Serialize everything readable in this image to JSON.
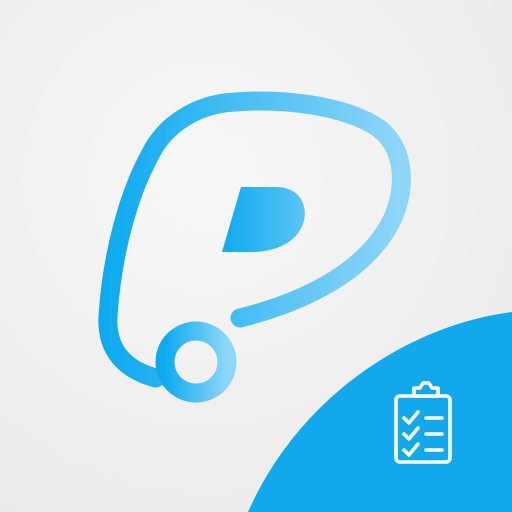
{
  "icon": {
    "logo_name": "p-logo-icon",
    "badge_name": "clipboard-checklist-icon",
    "colors": {
      "background_light": "#f7f7f7",
      "background_dark": "#e9e9e9",
      "logo_start": "#0eaaf0",
      "logo_end": "#8ed6f8",
      "accent": "#12a9ec",
      "badge_icon": "#ffffff"
    }
  }
}
